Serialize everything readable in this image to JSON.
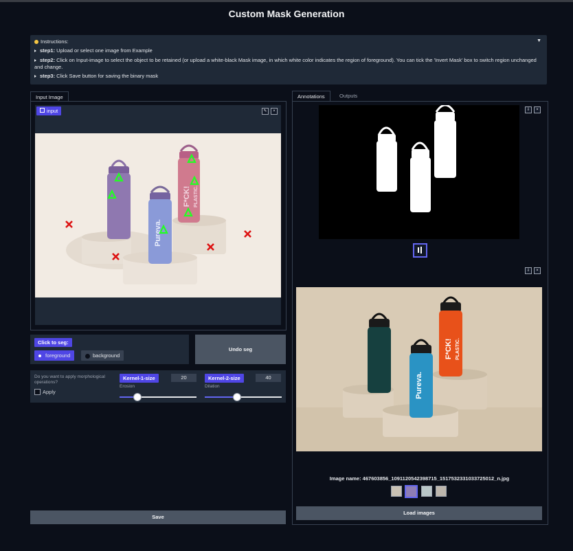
{
  "title": "Custom Mask Generation",
  "instructions": {
    "header": "Instructions:",
    "step1_label": "step1:",
    "step1_text": " Upload or select one image from Example",
    "step2_label": "step2:",
    "step2_text": " Click on Input-image to select the object to be retained (or upload a white-black Mask image, in which white color indicates the region of foreground). You can tick the 'Invert Mask' box to switch region unchanged and change.",
    "step3_label": "step3:",
    "step3_text": " Click Save button for saving the binary mask"
  },
  "left": {
    "tab": "Input Image",
    "input_chip": "input",
    "click_to_seg": "Click to seg:",
    "foreground": "foreground",
    "background": "background",
    "undo_seg": "Undo seg",
    "morph_question": "Do you want to apply morphological operations?",
    "apply": "Apply",
    "kernel1_label": "Kernel-1-size",
    "kernel1_value": "20",
    "kernel1_sub": "Erosion",
    "kernel2_label": "Kernel-2-size",
    "kernel2_value": "40",
    "kernel2_sub": "Dilation",
    "save": "Save"
  },
  "right": {
    "tab_annotations": "Annotations",
    "tab_outputs": "Outputs",
    "image_name": "Image name: 467603856_1091120542398715_1517532331033725012_n.jpg",
    "load_images": "Load images"
  },
  "product_text": {
    "bottle_a": "Pureva.",
    "bottle_b": "F*CK!",
    "bottle_c": "PLASTIC."
  },
  "colors": {
    "accent": "#4f46e5",
    "panel": "#1f2937",
    "bg": "#0b0f19",
    "marker_positive": "#22ff22",
    "marker_negative": "#dd1111"
  }
}
